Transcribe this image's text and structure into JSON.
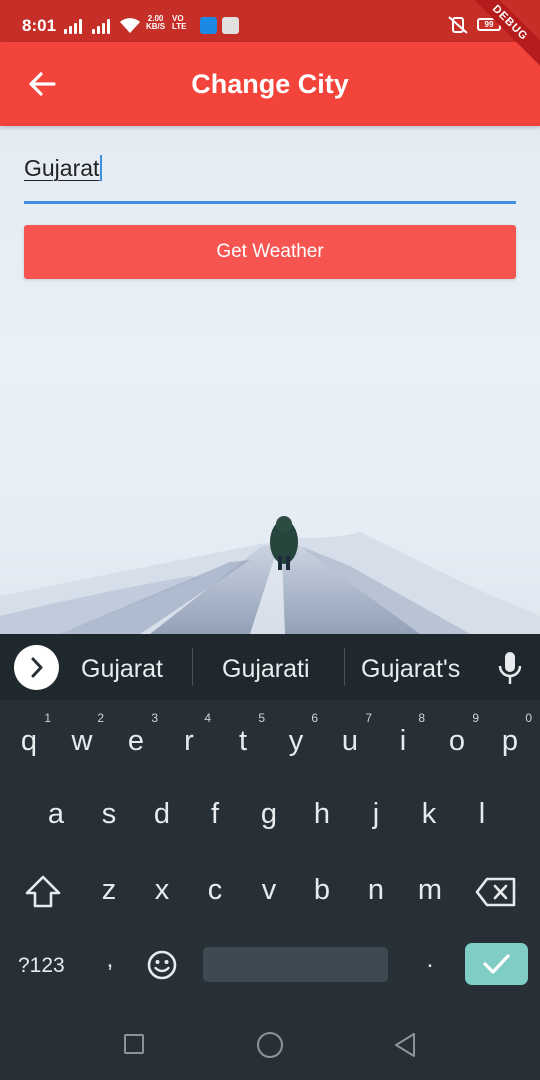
{
  "status_bar": {
    "time": "8:01",
    "net_speed_value": "2.00",
    "net_speed_unit": "KB/S",
    "volte_line1": "VO",
    "volte_line2": "LTE",
    "battery": "99",
    "debug_label": "DEBUG"
  },
  "app_bar": {
    "title": "Change City",
    "back_icon": "arrow-back-icon"
  },
  "form": {
    "city_value": "Gujarat",
    "button_label": "Get Weather"
  },
  "keyboard": {
    "suggestions": [
      "Gujarat",
      "Gujarati",
      "Gujarat's"
    ],
    "row1": [
      {
        "key": "q",
        "hint": "1"
      },
      {
        "key": "w",
        "hint": "2"
      },
      {
        "key": "e",
        "hint": "3"
      },
      {
        "key": "r",
        "hint": "4"
      },
      {
        "key": "t",
        "hint": "5"
      },
      {
        "key": "y",
        "hint": "6"
      },
      {
        "key": "u",
        "hint": "7"
      },
      {
        "key": "i",
        "hint": "8"
      },
      {
        "key": "o",
        "hint": "9"
      },
      {
        "key": "p",
        "hint": "0"
      }
    ],
    "row2": [
      "a",
      "s",
      "d",
      "f",
      "g",
      "h",
      "j",
      "k",
      "l"
    ],
    "row3": [
      "z",
      "x",
      "c",
      "v",
      "b",
      "n",
      "m"
    ],
    "symbols_key": "?123",
    "comma_key": ",",
    "period_key": "."
  },
  "colors": {
    "status_bar": "#c62e28",
    "app_bar": "#f2443a",
    "button": "#f55451",
    "input_underline": "#3f8fdc",
    "keyboard_bg": "#263036",
    "enter_key": "#7fcdc4"
  }
}
